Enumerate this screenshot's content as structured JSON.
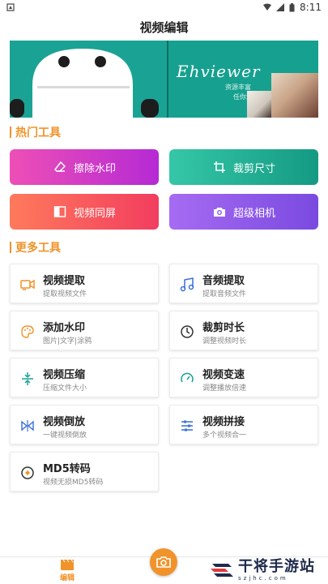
{
  "status_bar": {
    "time": "8:11"
  },
  "title": "视频编辑",
  "banner": {
    "title": "Ehviewer",
    "subtitle_1": "资源丰富",
    "subtitle_2": "任你浏览"
  },
  "hot_tools": {
    "header": "热门工具",
    "items": [
      {
        "label": "擦除水印",
        "icon": "eraser-icon",
        "color_from": "#ee4fb6",
        "color_to": "#b52ad4"
      },
      {
        "label": "裁剪尺寸",
        "icon": "crop-icon",
        "color_from": "#35c7a7",
        "color_to": "#149a83"
      },
      {
        "label": "视频同屏",
        "icon": "split-screen-icon",
        "color_from": "#ff7a5c",
        "color_to": "#f23d5f"
      },
      {
        "label": "超级相机",
        "icon": "camera-icon",
        "color_from": "#a66bf2",
        "color_to": "#7a4ae0"
      }
    ]
  },
  "more_tools": {
    "header": "更多工具",
    "items": [
      {
        "name": "视频提取",
        "desc": "提取视频文件",
        "icon": "video-extract-icon"
      },
      {
        "name": "音频提取",
        "desc": "提取音频文件",
        "icon": "music-note-icon"
      },
      {
        "name": "添加水印",
        "desc": "图片|文字|涂鸦",
        "icon": "palette-icon"
      },
      {
        "name": "裁剪时长",
        "desc": "调整视频时长",
        "icon": "timer-icon"
      },
      {
        "name": "视频压缩",
        "desc": "压缩文件大小",
        "icon": "compress-icon"
      },
      {
        "name": "视频变速",
        "desc": "调整播放倍速",
        "icon": "speedometer-icon"
      },
      {
        "name": "视频倒放",
        "desc": "一键视频倒放",
        "icon": "reverse-icon"
      },
      {
        "name": "视频拼接",
        "desc": "多个视频合一",
        "icon": "sliders-icon"
      },
      {
        "name": "MD5转码",
        "desc": "视频无损MD5转码",
        "icon": "md5-icon"
      }
    ]
  },
  "bottom_nav": {
    "edit_label": "编辑",
    "accent": "#f0932b"
  },
  "watermark": {
    "main": "干将手游站",
    "sub": "szjhc.com"
  }
}
